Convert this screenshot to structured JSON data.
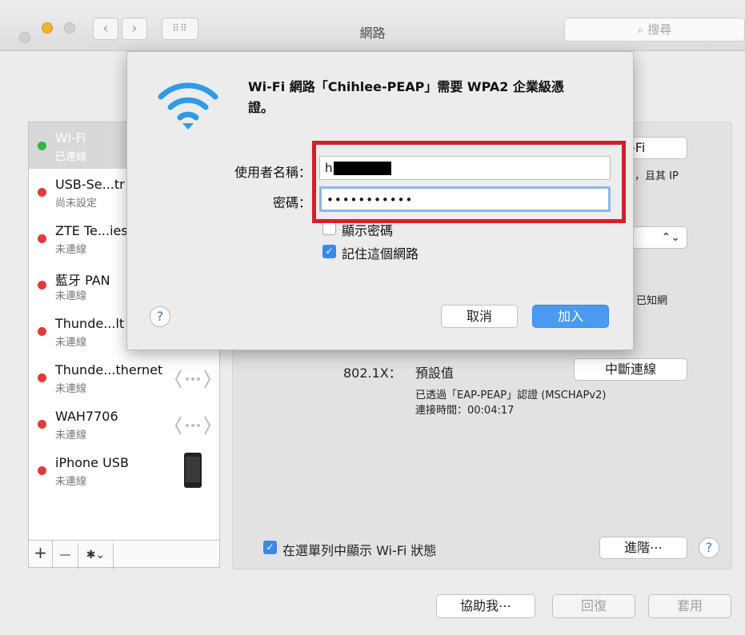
{
  "window": {
    "title": "網路",
    "search_placeholder": "搜尋"
  },
  "sidebar": {
    "services": [
      {
        "name": "Wi-Fi",
        "status": "已連線",
        "color": "#2fb846",
        "selected": true
      },
      {
        "name": "USB-Se...tr",
        "status": "尚未設定",
        "color": "#e23a3a"
      },
      {
        "name": "ZTE Te...ies",
        "status": "未連線",
        "color": "#e23a3a"
      },
      {
        "name": "藍牙 PAN",
        "status": "未連線",
        "color": "#e23a3a"
      },
      {
        "name": "Thunde...lt",
        "status": "未連線",
        "color": "#e23a3a"
      },
      {
        "name": "Thunde...thernet",
        "status": "未連線",
        "color": "#e23a3a",
        "icon": "ethernet-icon"
      },
      {
        "name": "WAH7706",
        "status": "未連線",
        "color": "#e23a3a",
        "icon": "ethernet-icon"
      },
      {
        "name": "iPhone USB",
        "status": "未連線",
        "color": "#e23a3a",
        "icon": "iphone-icon"
      }
    ],
    "toolbar": {
      "add": "+",
      "remove": "—",
      "gear": "✱⌄"
    }
  },
  "main": {
    "wifi_button_partial": "-Fi",
    "ip_text_partial": "，且其 IP",
    "known_text_partial": "已知網",
    "dot1x_label": "802.1X：",
    "dot1x_value": "預設值",
    "disconnect_label": "中斷連線",
    "auth_info": "已透過「EAP-PEAP」認證 (MSCHAPv2)",
    "connect_time": "連接時間：00:04:17",
    "show_wifi_status": "在選單列中顯示 Wi-Fi 狀態",
    "advanced_label": "進階⋯",
    "help_label": "?"
  },
  "footer": {
    "assist_label": "協助我⋯",
    "revert_label": "回復",
    "apply_label": "套用"
  },
  "dialog": {
    "message": "Wi-Fi 網路「Chihlee-PEAP」需要 WPA2 企業級憑",
    "message_line2": "證。",
    "username_label": "使用者名稱：",
    "username_value": "h",
    "password_label": "密碼：",
    "password_value": "•••••••••••",
    "show_password": "顯示密碼",
    "remember_network": "記住這個網路",
    "cancel_label": "取消",
    "join_label": "加入",
    "help_label": "?"
  },
  "colors": {
    "accent": "#3b88e8",
    "highlight_box": "#d2202b",
    "connected": "#2fb846",
    "disconnected": "#e23a3a"
  }
}
